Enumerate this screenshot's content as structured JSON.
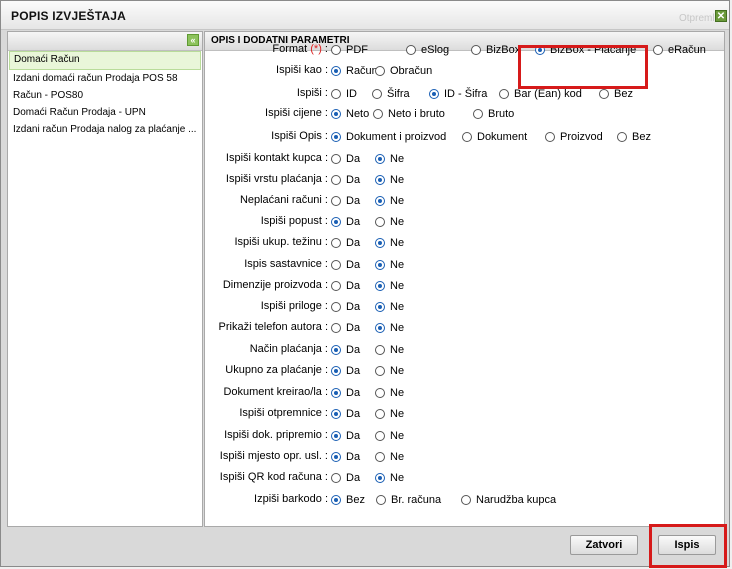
{
  "window": {
    "title": "POPIS IZVJEŠTAJA",
    "ghost_text": "Otpreml",
    "close_glyph": "✕"
  },
  "left": {
    "collapse_glyph": "«",
    "items": [
      "Domaći Račun",
      "Izdani domaći račun Prodaja POS 58",
      "Račun - POS80",
      "Domaći Račun Prodaja - UPN",
      "Izdani račun Prodaja nalog za plaćanje ..."
    ],
    "selected_index": 0
  },
  "right": {
    "header": "OPIS I DODATNI PARAMETRI",
    "rows": [
      {
        "label": "Format",
        "required": "(*)",
        "suffix": " :",
        "options": [
          "PDF",
          "eSlog",
          "BizBox",
          "BizBox - Plaćanje",
          "eRačun"
        ],
        "selected": 3
      },
      {
        "label": "Ispiši kao :",
        "options": [
          "Račun",
          "Obračun"
        ],
        "selected": 0
      },
      {
        "label": "Ispiši :",
        "options": [
          "ID",
          "Šifra",
          "ID - Šifra",
          "Bar (Ean) kod",
          "Bez"
        ],
        "selected": 2
      },
      {
        "label": "Ispiši cijene :",
        "options": [
          "Neto",
          "Neto i bruto",
          "Bruto"
        ],
        "selected": 0
      },
      {
        "label": "Ispiši Opis :",
        "options": [
          "Dokument i proizvod",
          "Dokument",
          "Proizvod",
          "Bez"
        ],
        "selected": 0
      },
      {
        "label": "Ispiši kontakt kupca :",
        "options": [
          "Da",
          "Ne"
        ],
        "selected": 1
      },
      {
        "label": "Ispiši vrstu plaćanja :",
        "options": [
          "Da",
          "Ne"
        ],
        "selected": 1
      },
      {
        "label": "Neplaćani računi :",
        "options": [
          "Da",
          "Ne"
        ],
        "selected": 1
      },
      {
        "label": "Ispiši popust :",
        "options": [
          "Da",
          "Ne"
        ],
        "selected": 0
      },
      {
        "label": "Ispiši ukup. težinu :",
        "options": [
          "Da",
          "Ne"
        ],
        "selected": 1
      },
      {
        "label": "Ispis sastavnice :",
        "options": [
          "Da",
          "Ne"
        ],
        "selected": 1
      },
      {
        "label": "Dimenzije proizvoda :",
        "options": [
          "Da",
          "Ne"
        ],
        "selected": 1
      },
      {
        "label": "Ispiši priloge :",
        "options": [
          "Da",
          "Ne"
        ],
        "selected": 1
      },
      {
        "label": "Prikaži telefon autora :",
        "options": [
          "Da",
          "Ne"
        ],
        "selected": 1
      },
      {
        "label": "Način plaćanja :",
        "options": [
          "Da",
          "Ne"
        ],
        "selected": 0
      },
      {
        "label": "Ukupno za plaćanje :",
        "options": [
          "Da",
          "Ne"
        ],
        "selected": 0
      },
      {
        "label": "Dokument kreirao/la :",
        "options": [
          "Da",
          "Ne"
        ],
        "selected": 0
      },
      {
        "label": "Ispiši otpremnice :",
        "options": [
          "Da",
          "Ne"
        ],
        "selected": 0
      },
      {
        "label": "Ispiši dok. pripremio :",
        "options": [
          "Da",
          "Ne"
        ],
        "selected": 0
      },
      {
        "label": "Ispiši mjesto opr. usl. :",
        "options": [
          "Da",
          "Ne"
        ],
        "selected": 0
      },
      {
        "label": "Ispiši QR kod računa :",
        "options": [
          "Da",
          "Ne"
        ],
        "selected": 1
      },
      {
        "label": "Izpiši barkodo :",
        "options": [
          "Bez",
          "Br. računa",
          "Narudžba kupca"
        ],
        "selected": 0
      }
    ]
  },
  "footer": {
    "close_label": "Zatvori",
    "print_label": "Ispis"
  },
  "colors": {
    "highlight": "#d61a1a",
    "radio_selected": "#1a5fb4",
    "selected_item_bg": "#e9f6d9"
  }
}
